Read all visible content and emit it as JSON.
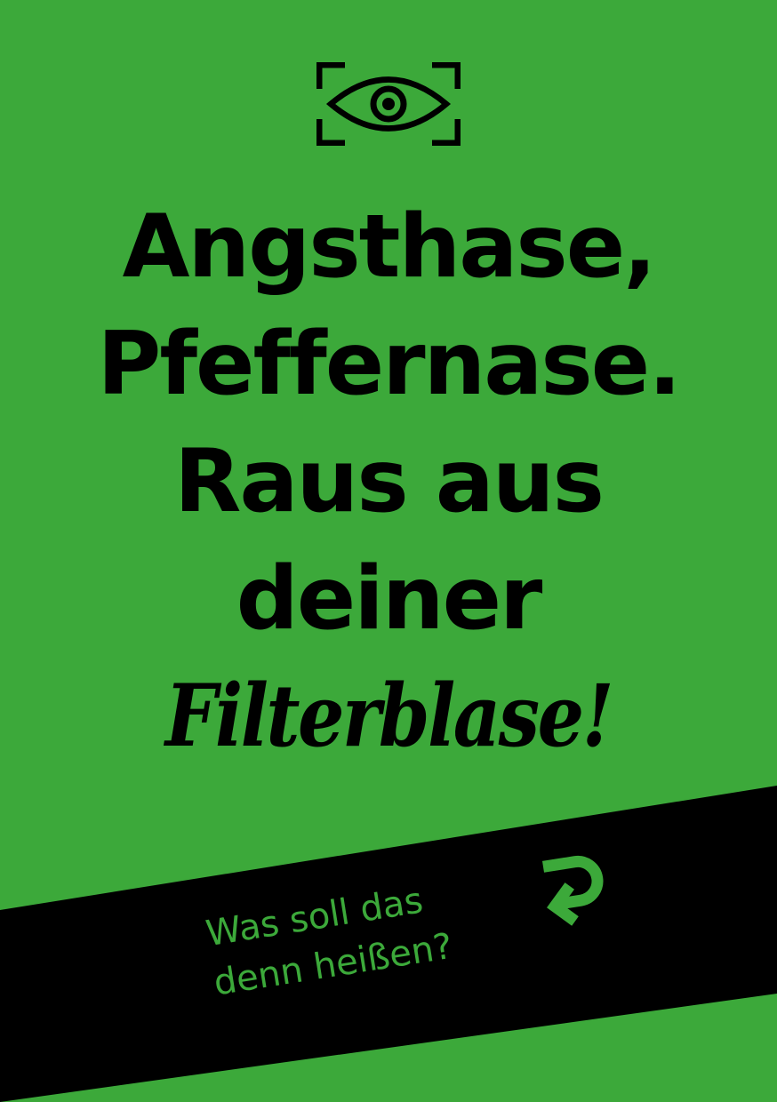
{
  "colors": {
    "background": "#3ca93a",
    "text": "#000000",
    "band": "#000000",
    "accent_text": "#3ca93a"
  },
  "icons": {
    "top": "eye-in-viewfinder-icon",
    "arrow": "return-arrow-icon"
  },
  "headline": {
    "line1": "Angsthase,",
    "line2": "Pfeffernase.",
    "line3": "Raus aus",
    "line4": "deiner",
    "line5": "Filterblase!"
  },
  "cta": {
    "line1": "Was soll das",
    "line2": "denn heißen?"
  }
}
